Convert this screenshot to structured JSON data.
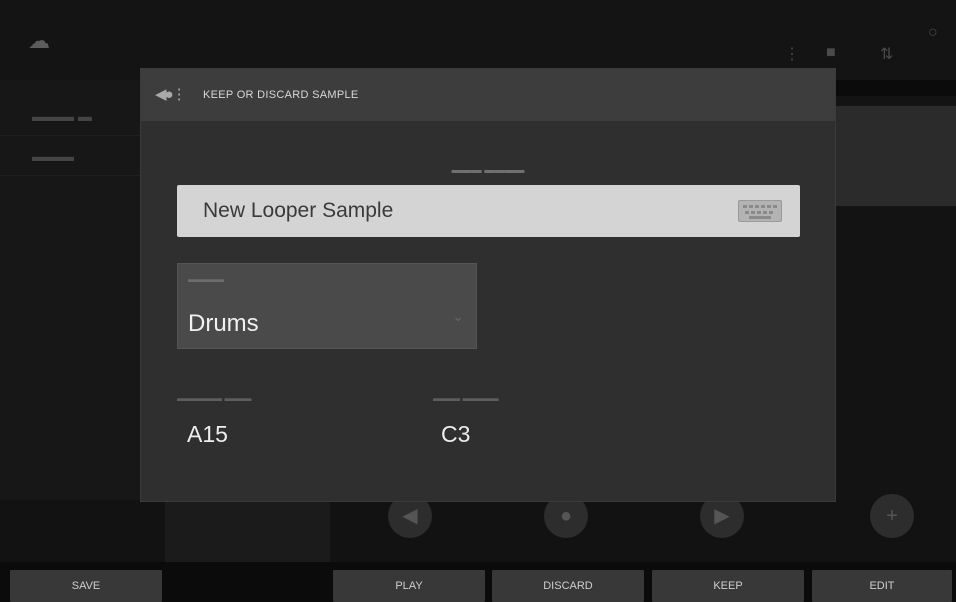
{
  "dialog": {
    "title": "KEEP OR DISCARD SAMPLE",
    "name_value": "New Looper Sample",
    "category_value": "Drums",
    "assign_value": "A15",
    "root_note_value": "C3"
  },
  "icons": {
    "header": "sample-waveform-icon",
    "keyboard": "keyboard-icon",
    "dropdown": "chevron-down-icon"
  },
  "function_bar": {
    "save": "SAVE",
    "play": "PLAY",
    "discard": "DISCARD",
    "keep": "KEEP",
    "edit": "EDIT"
  },
  "colors": {
    "modal_bg": "#2f2f2f",
    "modal_header": "#3d3d3d",
    "name_field_bg": "#d4d4d4",
    "button_bg": "#383838"
  }
}
